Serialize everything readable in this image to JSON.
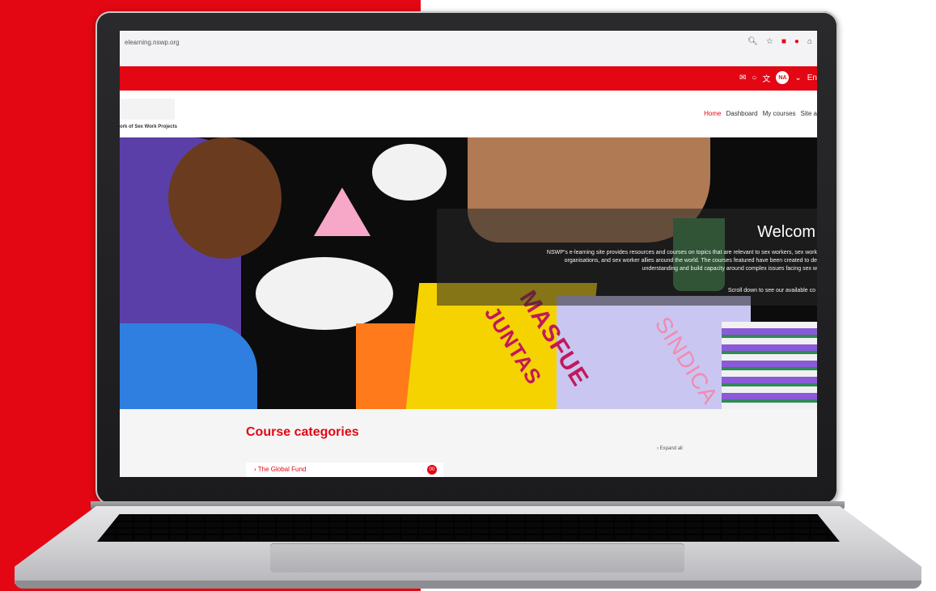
{
  "browser": {
    "url": "elearning.nswp.org",
    "icons": [
      "zoom-icon",
      "star-icon",
      "extension-icon",
      "extension-icon-2",
      "extension-icon-3"
    ]
  },
  "topbar": {
    "avatar_initials": "NA",
    "language_fragment": "En"
  },
  "navbar": {
    "logo_text": "ork of Sex Work Projects",
    "links": [
      "Home",
      "Dashboard",
      "My courses",
      "Site a"
    ]
  },
  "hero": {
    "title_fragment": "Welcom",
    "body_line_1": "NSWP’s e-learning site provides resources and courses on topics that are relevant to sex workers, sex work",
    "body_line_2": "organisations, and sex worker allies around the world. The courses featured have been created to de",
    "body_line_3": "understanding and build capacity around complex issues facing sex w",
    "scroll_text": "Scroll down to see our available co",
    "sign_text_1": "MASFUE",
    "sign_text_2": "JUNTAS",
    "sign_text_3": "SINDICA"
  },
  "content": {
    "title": "Course categories",
    "expand_all": "Expand all",
    "categories": [
      {
        "label": "The Global Fund",
        "count": "00"
      }
    ]
  },
  "colors": {
    "brand_red": "#e30613"
  }
}
